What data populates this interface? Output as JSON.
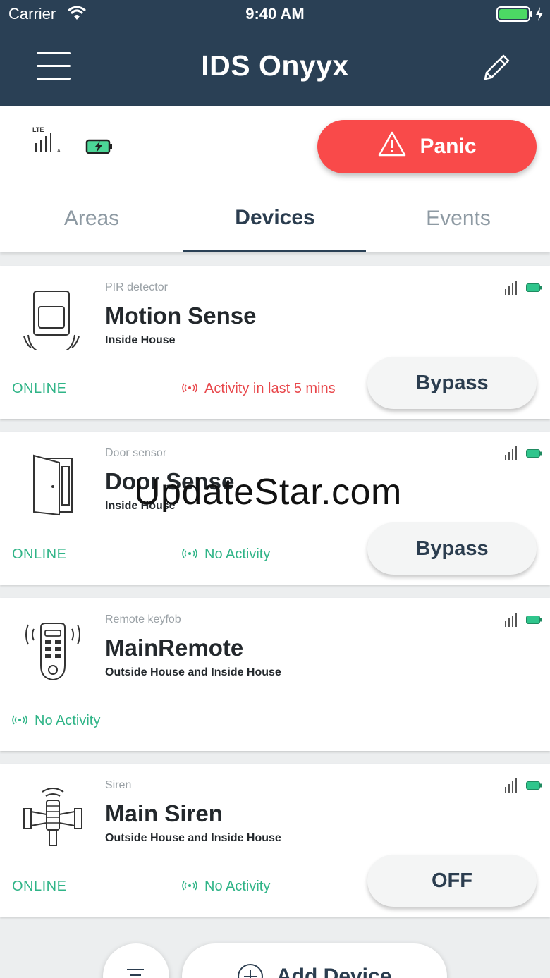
{
  "status_bar": {
    "carrier": "Carrier",
    "time": "9:40 AM"
  },
  "header": {
    "title": "IDS Onyyx"
  },
  "system": {
    "signal_label": "LTE",
    "signal_sub": "A",
    "panic_label": "Panic"
  },
  "tabs": [
    {
      "label": "Areas"
    },
    {
      "label": "Devices"
    },
    {
      "label": "Events"
    }
  ],
  "active_tab": "Devices",
  "devices": [
    {
      "type": "PIR detector",
      "name": "Motion Sense",
      "area": "Inside House",
      "status": "ONLINE",
      "activity": "Activity in last 5 mins",
      "action": "Bypass"
    },
    {
      "type": "Door sensor",
      "name": "Door Sense",
      "area": "Inside House",
      "status": "ONLINE",
      "activity": "No Activity",
      "action": "Bypass"
    },
    {
      "type": "Remote keyfob",
      "name": "MainRemote",
      "area": "Outside House and Inside House",
      "status": "",
      "activity": "No Activity",
      "action": ""
    },
    {
      "type": "Siren",
      "name": "Main Siren",
      "area": "Outside House and Inside House",
      "status": "ONLINE",
      "activity": "No Activity",
      "action": "OFF"
    }
  ],
  "watermark": "UpdateStar.com",
  "footer": {
    "add_device_label": "Add Device"
  },
  "colors": {
    "header_bg": "#2a4055",
    "panic": "#f94a4a",
    "online": "#2fb487",
    "alert": "#e8474b"
  }
}
